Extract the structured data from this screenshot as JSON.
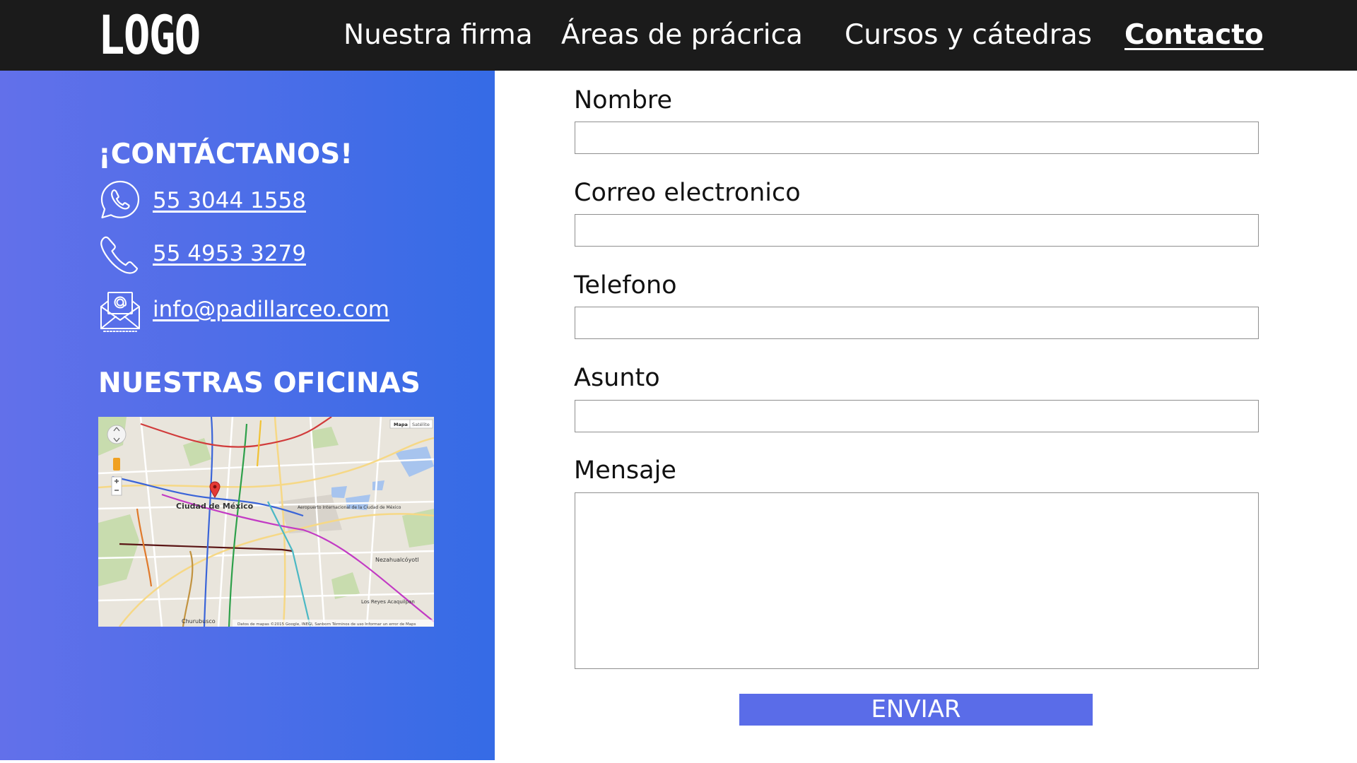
{
  "header": {
    "logo": "LOGO",
    "nav": [
      {
        "label": "Nuestra firma"
      },
      {
        "label": "Áreas de prácrica"
      },
      {
        "label": "Cursos y cátedras"
      },
      {
        "label": "Contacto",
        "active": true
      }
    ]
  },
  "contact": {
    "heading": "¡CONTÁCTANOS!",
    "whatsapp": "55 3044 1558",
    "phone": "55 4953 3279",
    "email": "info@padillarceo.com",
    "icons": [
      "whatsapp-icon",
      "phone-icon",
      "email-icon"
    ]
  },
  "offices": {
    "heading": "NUESTRAS OFICINAS",
    "map": {
      "map_button": "Mapa",
      "satellite_button": "Satélite",
      "city_label": "Ciudad de México",
      "airport_label": "Aeropuerto Internacional de la Ciudad de México",
      "neza_label": "Nezahualcóyotl",
      "reyes_label": "Los Reyes Acaquilpan",
      "churubusco_label": "Churubusco",
      "attribution": "Datos de mapas ©2015 Google, INEGI, Sanborn   Términos de uso   Informar un error de Maps"
    }
  },
  "form": {
    "name_label": "Nombre",
    "name_value": "",
    "email_label": "Correo electronico",
    "email_value": "",
    "phone_label": "Telefono",
    "phone_value": "",
    "subject_label": "Asunto",
    "subject_value": "",
    "message_label": "Mensaje",
    "message_value": "",
    "submit_label": "ENVIAR"
  },
  "colors": {
    "header_bg": "#1b1b1b",
    "panel_gradient_start": "#6270ea",
    "panel_gradient_end": "#356be6",
    "button_bg": "#5a6ce8"
  }
}
